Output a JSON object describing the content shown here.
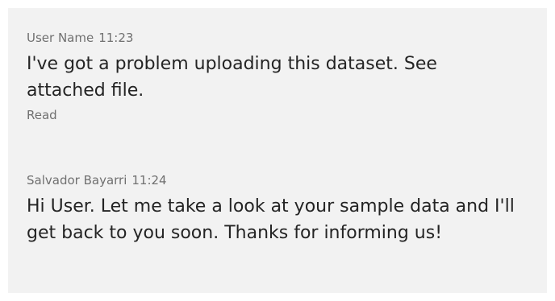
{
  "messages": [
    {
      "sender": "User Name",
      "time": "11:23",
      "text": "I've got a problem uploading this dataset. See attached file.",
      "status": "Read"
    },
    {
      "sender": "Salvador Bayarri",
      "time": "11:24",
      "text": "Hi User. Let me take a look at your sample data and I'll get back to you soon. Thanks for informing us!"
    }
  ],
  "colors": {
    "panel_background": "#f2f2f2",
    "meta_text": "#707070",
    "body_text": "#242424"
  }
}
